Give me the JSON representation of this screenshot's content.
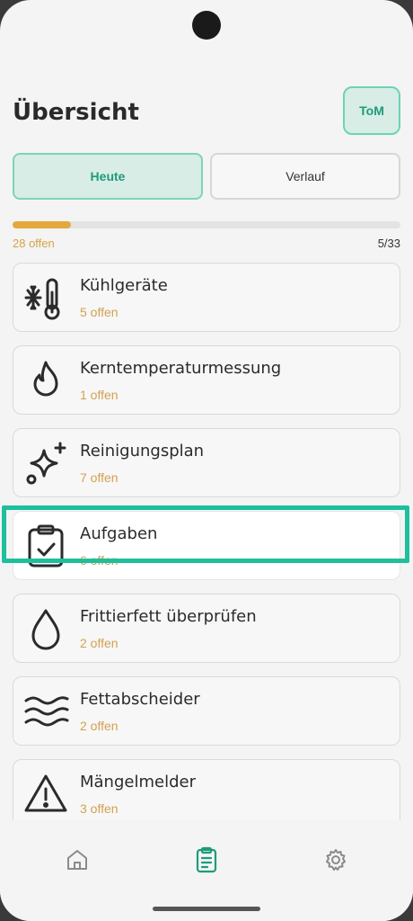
{
  "header": {
    "title": "Übersicht",
    "avatar": "ToM"
  },
  "tabs": [
    {
      "label": "Heute",
      "active": true
    },
    {
      "label": "Verlauf",
      "active": false
    }
  ],
  "progress": {
    "left_label": "28 offen",
    "right_label": "5/33",
    "fraction": 0.1515
  },
  "items": [
    {
      "label": "Kühlgeräte",
      "sub": "5 offen",
      "icon": "fridge-thermometer-icon"
    },
    {
      "label": "Kerntemperaturmessung",
      "sub": "1 offen",
      "icon": "flame-icon"
    },
    {
      "label": "Reinigungsplan",
      "sub": "7 offen",
      "icon": "sparkle-icon"
    },
    {
      "label": "Aufgaben",
      "sub": "6 offen",
      "icon": "clipboard-check-icon"
    },
    {
      "label": "Frittierfett überprüfen",
      "sub": "2 offen",
      "icon": "drop-icon"
    },
    {
      "label": "Fettabscheider",
      "sub": "2 offen",
      "icon": "waves-icon"
    },
    {
      "label": "Mängelmelder",
      "sub": "3 offen",
      "icon": "warning-icon"
    }
  ],
  "nav": [
    {
      "icon": "home-icon"
    },
    {
      "icon": "clipboard-list-icon",
      "active": true
    },
    {
      "icon": "gear-icon"
    }
  ],
  "colors": {
    "accent": "#1f9a7c",
    "highlight": "#1fbf9e",
    "orange": "#d3a14f"
  }
}
